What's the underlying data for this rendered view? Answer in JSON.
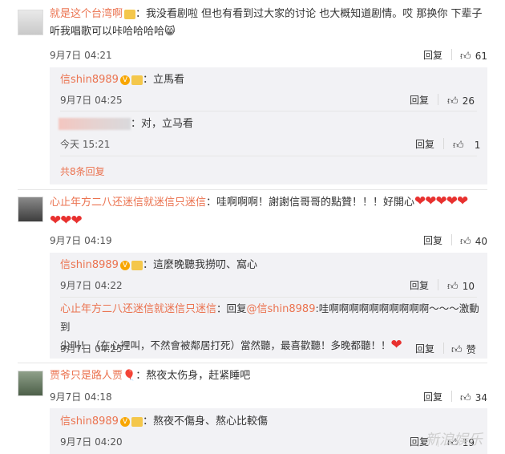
{
  "comments": [
    {
      "user": "就是这个台湾啊",
      "text_line1": "：我没看剧啦 但也有看到过大家的讨论 也大概知道剧情。哎 那换你 下辈子",
      "text_line2": "听我唱歌可以咔哈哈哈哈",
      "time": "9月7日 04:21",
      "reply_label": "回复",
      "likes": "61",
      "replies": [
        {
          "user": "信shin8989",
          "text": "：立馬看",
          "time": "9月7日 04:25",
          "reply_label": "回复",
          "likes": "26"
        },
        {
          "user": "",
          "text": "：对，立马看",
          "time": "今天 15:21",
          "reply_label": "回复",
          "likes": "1"
        }
      ],
      "more_label": "共8条回复"
    },
    {
      "user": "心止年方二八还迷信就迷信只迷信",
      "text_line1": "：哇啊啊啊！謝謝信哥哥的點贊！！！好開心",
      "time": "9月7日 04:19",
      "reply_label": "回复",
      "likes": "40",
      "replies": [
        {
          "user": "信shin8989",
          "text": "：這麼晚聽我撈叨、窩心",
          "time": "9月7日 04:22",
          "reply_label": "回复",
          "likes": "10"
        },
        {
          "user": "心止年方二八还迷信就迷信只迷信",
          "text_prefix": "：回复",
          "mention": "@信shin8989",
          "text_line1": ":哇啊啊啊啊啊啊啊啊啊啊～～～激動到",
          "text_line2": "尖叫！（在心裡叫，不然會被鄰居打死）當然聽，最喜歡聽！多晚都聽！！",
          "time": "9月7日 04:25",
          "reply_label": "回复",
          "likes": "赞"
        }
      ]
    },
    {
      "user": "贾爷只是路人贾",
      "text_line1": "：熬夜太伤身，赶紧睡吧",
      "time": "9月7日 04:18",
      "reply_label": "回复",
      "likes": "34",
      "replies": [
        {
          "user": "信shin8989",
          "text": "：熬夜不傷身、熬心比較傷",
          "time": "9月7日 04:20",
          "reply_label": "回复",
          "likes": "19"
        }
      ]
    }
  ],
  "watermark": "新浪娱乐",
  "colors": {
    "name": "#eb7350",
    "sub_bg": "#f2f2f5",
    "heart": "#e8312f"
  }
}
